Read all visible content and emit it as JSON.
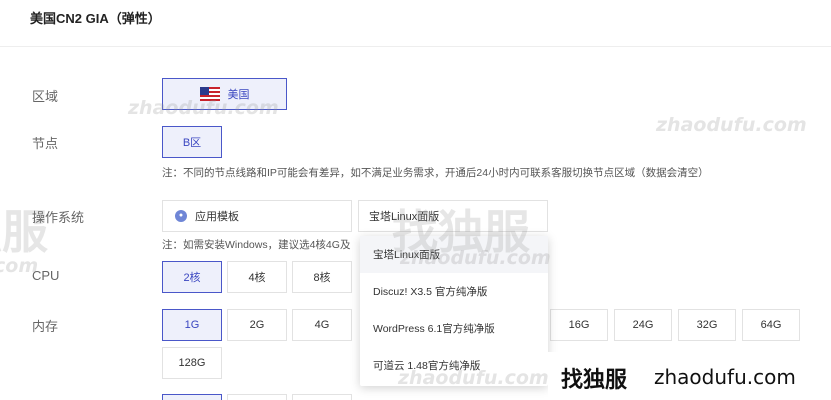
{
  "header": {
    "title": "美国CN2 GIA（弹性）"
  },
  "region": {
    "label": "区域",
    "option": "美国"
  },
  "node": {
    "label": "节点",
    "option": "B区",
    "note": "注：不同的节点线路和IP可能会有差异，如不满足业务需求，开通后24小时内可联系客服切换节点区域（数据会清空）"
  },
  "os": {
    "label": "操作系统",
    "type_value": "应用模板",
    "template_value": "宝塔Linux面版",
    "note": "注：如需安装Windows，建议选4核4G及",
    "dropdown": [
      "宝塔Linux面版",
      "Discuz! X3.5 官方纯净版",
      "WordPress 6.1官方纯净版",
      "可道云 1.48官方纯净版"
    ]
  },
  "cpu": {
    "label": "CPU",
    "options": [
      "2核",
      "4核",
      "8核"
    ]
  },
  "memory": {
    "label": "内存",
    "options": [
      "1G",
      "2G",
      "4G",
      "16G",
      "24G",
      "32G",
      "64G",
      "128G"
    ]
  },
  "watermarks": {
    "domain": "zhaodufu.com",
    "domain_short": "com",
    "cn": "找独服"
  },
  "brand": {
    "cn": "找独服",
    "en": "zhaodufu.com"
  },
  "colors": {
    "accent": "#4a57c9",
    "selected_bg": "#eef0fb"
  },
  "icons": {
    "region_flag": "us-flag-icon",
    "os_type": "app-template-icon"
  }
}
